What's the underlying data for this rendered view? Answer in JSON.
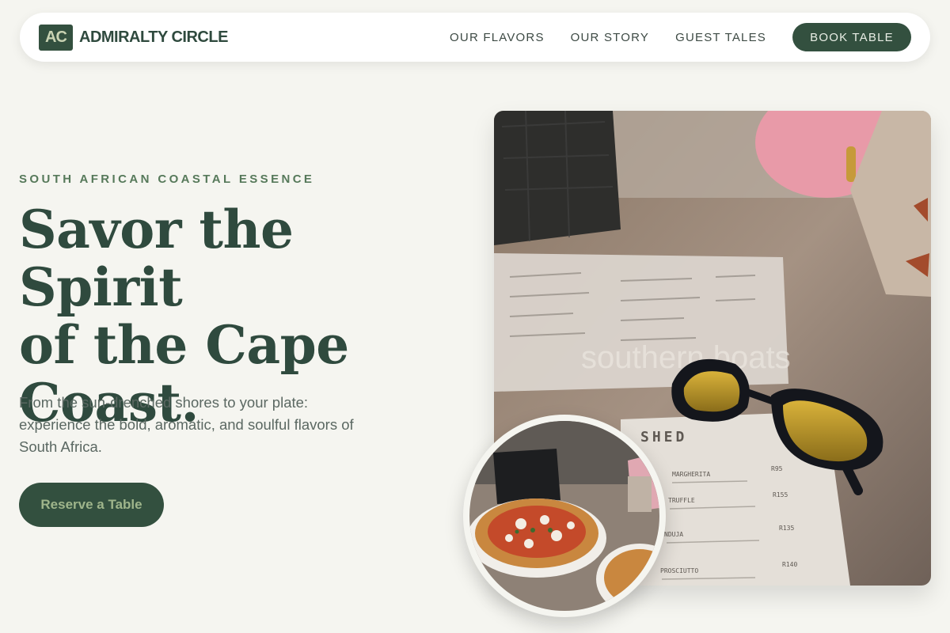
{
  "nav": {
    "logo_mark": "AC",
    "logo_text": "ADMIRALTY CIRCLE",
    "links": [
      "OUR FLAVORS",
      "OUR STORY",
      "GUEST TALES"
    ],
    "cta": "BOOK TABLE"
  },
  "hero": {
    "eyebrow": "SOUTH AFRICAN COASTAL ESSENCE",
    "headline_lines": [
      "Savor the Spirit",
      "of the Cape",
      "Coast."
    ],
    "lede": "From the sun-drenched shores to your plate: experience the bold, aromatic, and soulful flavors of South Africa.",
    "cta": "Reserve a Table"
  },
  "photo": {
    "watermark": "southern boats",
    "menu_title": "SHED",
    "menu_items": [
      {
        "name": "MARGHERITA",
        "price": "R95"
      },
      {
        "name": "TRUFFLE",
        "price": "R155"
      },
      {
        "name": "NDUJA",
        "price": "R135"
      },
      {
        "name": "PROSCIUTTO",
        "price": "R140"
      }
    ]
  },
  "colors": {
    "brand": "#33503f",
    "background": "#f5f5f0",
    "accent_text": "#56795a"
  }
}
